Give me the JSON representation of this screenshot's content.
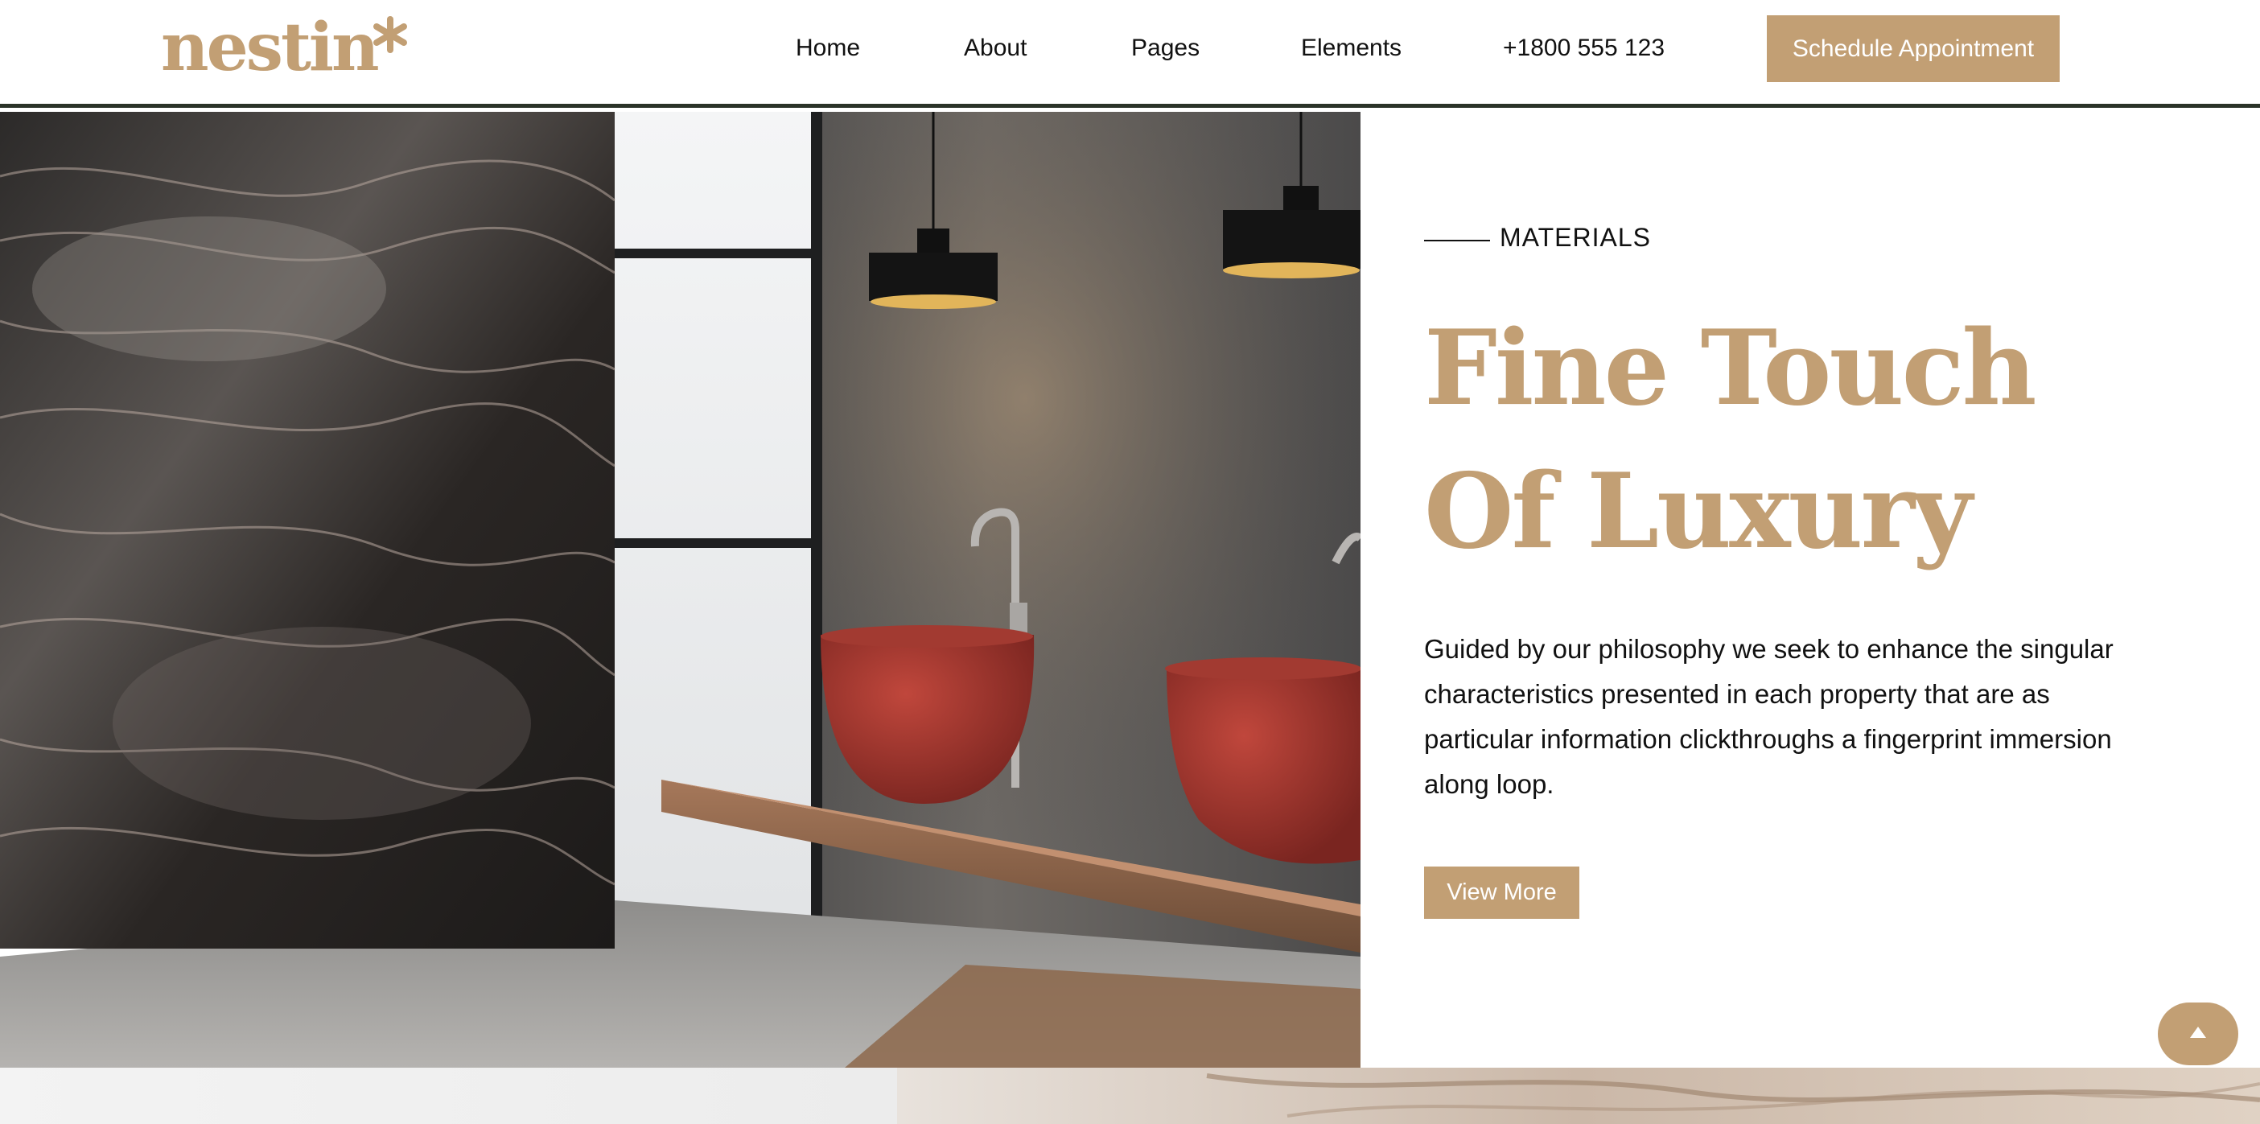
{
  "header": {
    "logo": "nestin",
    "nav": [
      {
        "label": "Home"
      },
      {
        "label": "About"
      },
      {
        "label": "Pages"
      },
      {
        "label": "Elements"
      },
      {
        "label": "+1800 555 123"
      }
    ],
    "cta_label": "Schedule Appointment"
  },
  "hero": {
    "image": "bathroom-interior-photo"
  },
  "content": {
    "eyebrow": "MATERIALS",
    "title": "Fine Touch Of Luxury",
    "description": "Guided by our philosophy we seek to enhance the singular characteristics presented in each property that are as particular information clickthroughs a fingerprint immersion along loop.",
    "button_label": "View More"
  },
  "scroll_top": {
    "icon": "arrow-up-icon"
  },
  "colors": {
    "accent": "#c29f74",
    "text": "#111111",
    "header_border": "#2a3328",
    "background": "#ffffff"
  }
}
